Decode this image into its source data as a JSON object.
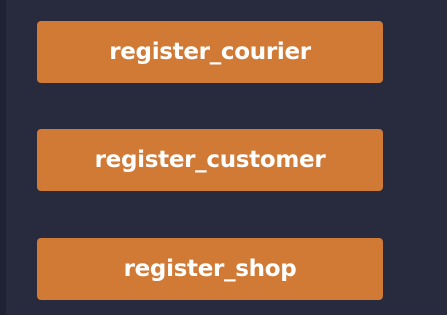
{
  "buttons": [
    {
      "label": "register_courier"
    },
    {
      "label": "register_customer"
    },
    {
      "label": "register_shop"
    }
  ],
  "colors": {
    "background": "#282b3d",
    "button": "#d07a35",
    "button_text": "#ffffff"
  }
}
